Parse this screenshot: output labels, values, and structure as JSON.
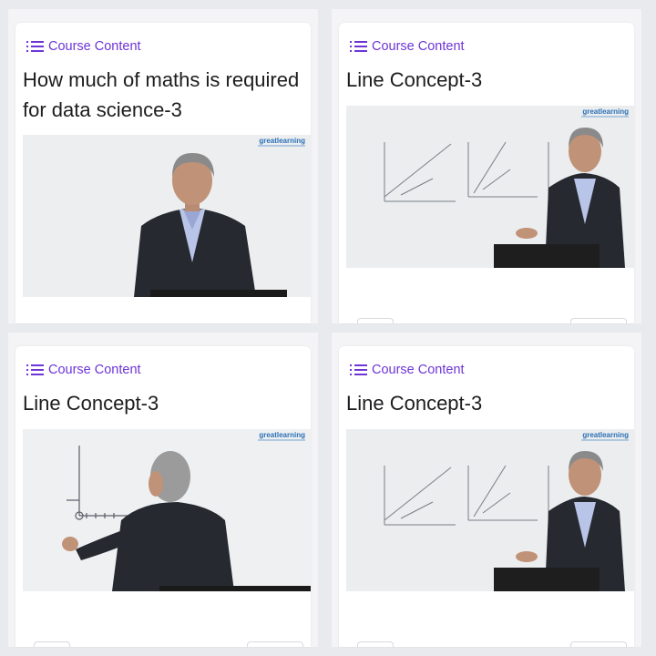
{
  "cards": [
    {
      "link_label": "Course Content",
      "title": "How much of maths is required for data science-3",
      "video_scene": "seated-presenter",
      "brand": "greatlearning"
    },
    {
      "link_label": "Course Content",
      "title": "Line Concept-3",
      "video_scene": "whiteboard-presenter-right",
      "brand": "greatlearning"
    },
    {
      "link_label": "Course Content",
      "title": "Line Concept-3",
      "video_scene": "presenter-writing-on-board",
      "brand": "greatlearning"
    },
    {
      "link_label": "Course Content",
      "title": "Line Concept-3",
      "video_scene": "whiteboard-presenter-right",
      "brand": "greatlearning"
    }
  ],
  "colors": {
    "accent": "#6e35d6",
    "brand": "#2a6fb5"
  }
}
